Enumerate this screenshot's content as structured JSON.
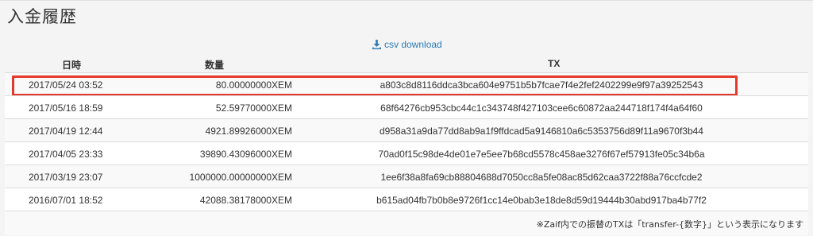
{
  "page": {
    "title": "入金履歴"
  },
  "download": {
    "label": "csv download",
    "icon": "download-icon",
    "color": "#2a7ab8"
  },
  "table": {
    "columns": {
      "date": "日時",
      "amount": "数量",
      "tx": "TX"
    },
    "rows": [
      {
        "date": "2017/05/24 03:52",
        "amount": "80.00000000XEM",
        "tx": "a803c8d8116ddca3bca604e9751b5b7fcae7f4e2fef2402299e9f97a39252543"
      },
      {
        "date": "2017/05/16 18:59",
        "amount": "52.59770000XEM",
        "tx": "68f64276cb953cbc44c1c343748f427103cee6c60872aa244718f174f4a64f60"
      },
      {
        "date": "2017/04/19 12:44",
        "amount": "4921.89926000XEM",
        "tx": "d958a31a9da77dd8ab9a1f9ffdcad5a9146810a6c5353756d89f11a9670f3b44"
      },
      {
        "date": "2017/04/05 23:33",
        "amount": "39890.43096000XEM",
        "tx": "70ad0f15c98de4de01e7e5ee7b68cd5578c458ae3276f67ef57913fe05c34b6a"
      },
      {
        "date": "2017/03/19 23:07",
        "amount": "1000000.00000000XEM",
        "tx": "1ee6f38a8fa69cb88804688d7050cc8a5fe08ac85d62caa3722f88a76ccfcde2"
      },
      {
        "date": "2016/07/01 18:52",
        "amount": "42088.38178000XEM",
        "tx": "b615ad04fb7b0b8e9726f1cc14e0bab3e18de8d59d19444b30abd917ba4b77f2"
      }
    ],
    "highlight_color": "#e43a2d"
  },
  "footer": {
    "note": "※Zaif内での振替のTXは「transfer-{数字}」という表示になります"
  }
}
